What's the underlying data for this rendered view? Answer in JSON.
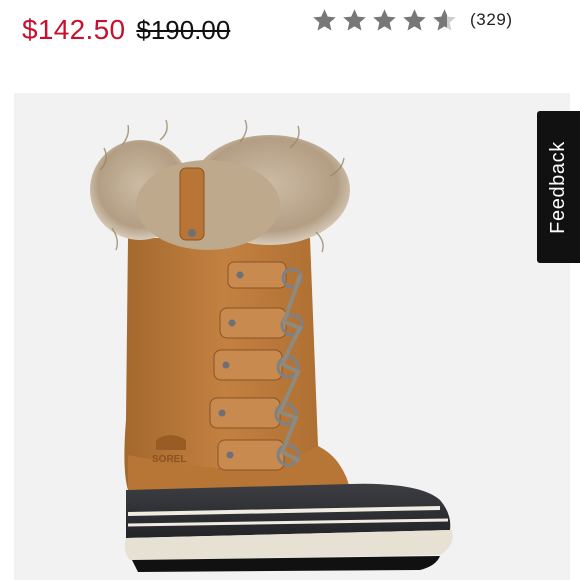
{
  "pricing": {
    "sale_price": "$142.50",
    "original_price": "$190.00",
    "sale_color": "#c8102e"
  },
  "rating": {
    "value": 4.5,
    "max": 5,
    "review_count": "(329)",
    "star_icon": "star-icon"
  },
  "product_image": {
    "brand_mark": "SOREL"
  },
  "feedback": {
    "label": "Feedback"
  },
  "colors": {
    "star": "#777777",
    "panel_bg": "#f2f2f2",
    "feedback_bg": "#111111"
  }
}
